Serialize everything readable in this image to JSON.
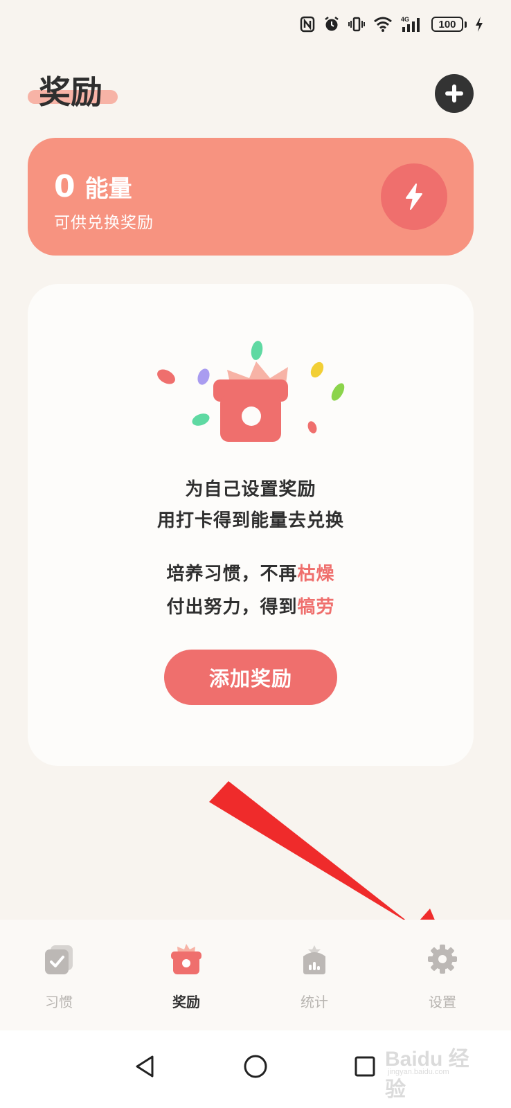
{
  "status_bar": {
    "battery": "100",
    "network": "4G",
    "icons": [
      "nfc-icon",
      "alarm-icon",
      "vibrate-icon",
      "wifi-icon",
      "cellular-signal-icon",
      "battery-icon",
      "charging-icon"
    ]
  },
  "header": {
    "title": "奖励",
    "add_icon": "plus-icon"
  },
  "energy": {
    "value": "0",
    "unit": "能量",
    "subtitle": "可供兑换奖励",
    "icon": "lightning-icon"
  },
  "empty_state": {
    "title_line1": "为自己设置奖励",
    "title_line2": "用打卡得到能量去兑换",
    "motto1_prefix": "培养习惯，不再",
    "motto1_accent": "枯燥",
    "motto2_prefix": "付出努力，得到",
    "motto2_accent": "犒劳",
    "button_label": "添加奖励",
    "illustration": "gift-box-icon"
  },
  "tabs": [
    {
      "label": "习惯",
      "icon": "checklist-icon",
      "active": false
    },
    {
      "label": "奖励",
      "icon": "gift-icon",
      "active": true
    },
    {
      "label": "统计",
      "icon": "stats-icon",
      "active": false
    },
    {
      "label": "设置",
      "icon": "gear-icon",
      "active": false
    }
  ],
  "watermark": {
    "brand": "Baidu 经验",
    "url": "jingyan.baidu.com"
  },
  "colors": {
    "background": "#f8f4ef",
    "accent": "#ef6f6d",
    "energy_card": "#f79380",
    "annotation_arrow": "#ef2b2b"
  }
}
